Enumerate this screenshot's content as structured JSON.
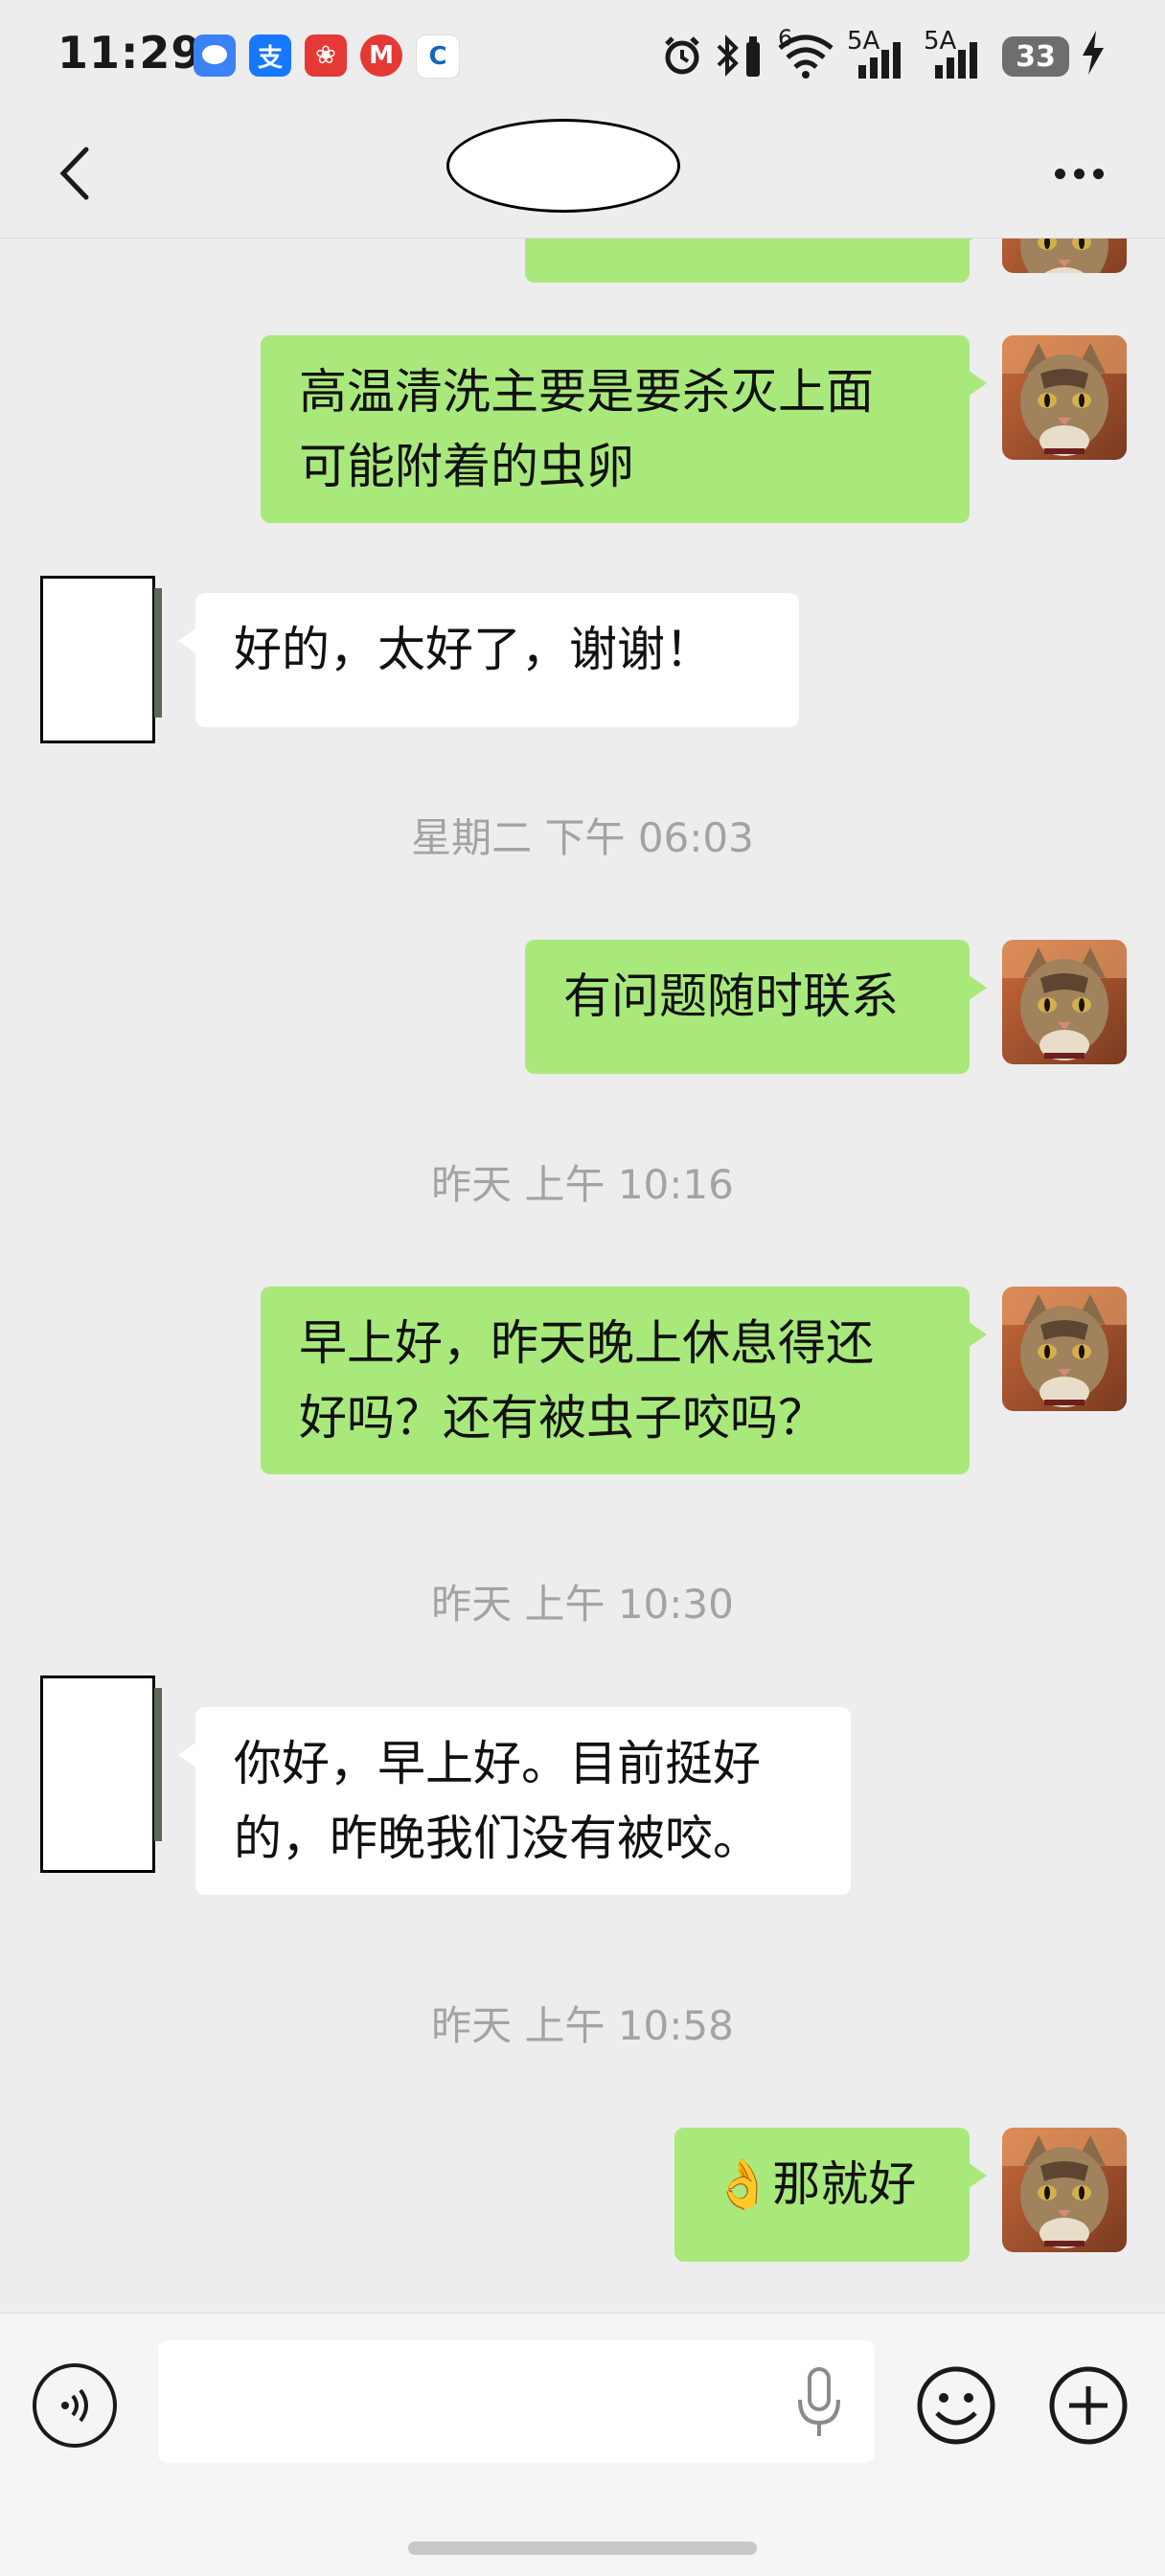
{
  "status_bar": {
    "time": "11:29",
    "apps": [
      {
        "icon": "message-app-icon",
        "glyph": "",
        "color": "#3b82f6"
      },
      {
        "icon": "alipay-icon",
        "glyph": "支",
        "color": "#1677ff"
      },
      {
        "icon": "flower-app-icon",
        "glyph": "❀",
        "color": "#e53935"
      },
      {
        "icon": "bank-app-icon",
        "glyph": "M",
        "color": "#e53935"
      },
      {
        "icon": "ccb-bank-icon",
        "glyph": "C",
        "color": "#1565c0"
      }
    ],
    "network_1": "6",
    "network_2": "5A",
    "network_3": "5A",
    "battery": "33"
  },
  "nav": {
    "back_icon": "back-chevron-icon",
    "more_icon": "more-dots-icon"
  },
  "messages": [
    {
      "side": "me",
      "text": "…",
      "partial": true
    },
    {
      "side": "me",
      "lines": [
        "高温清洗主要是要杀灭上面",
        "可能附着的虫卵"
      ]
    },
    {
      "side": "them",
      "lines": [
        "好的，太好了，谢谢！"
      ]
    },
    {
      "timestamp": "星期二 下午 06:03"
    },
    {
      "side": "me",
      "lines": [
        "有问题随时联系"
      ]
    },
    {
      "timestamp": "昨天 上午 10:16"
    },
    {
      "side": "me",
      "lines": [
        "早上好，昨天晚上休息得还",
        "好吗？还有被虫子咬吗？"
      ]
    },
    {
      "timestamp": "昨天 上午 10:30"
    },
    {
      "side": "them",
      "lines": [
        "你好，早上好。目前挺好",
        "的，昨晚我们没有被咬。"
      ]
    },
    {
      "timestamp": "昨天 上午 10:58"
    },
    {
      "side": "me",
      "lines": [
        "👌那就好"
      ]
    }
  ],
  "input": {
    "placeholder": "",
    "voice_icon": "voice-toggle-icon",
    "mic_icon": "microphone-icon",
    "emoji_icon": "emoji-icon",
    "plus_icon": "plus-icon"
  }
}
